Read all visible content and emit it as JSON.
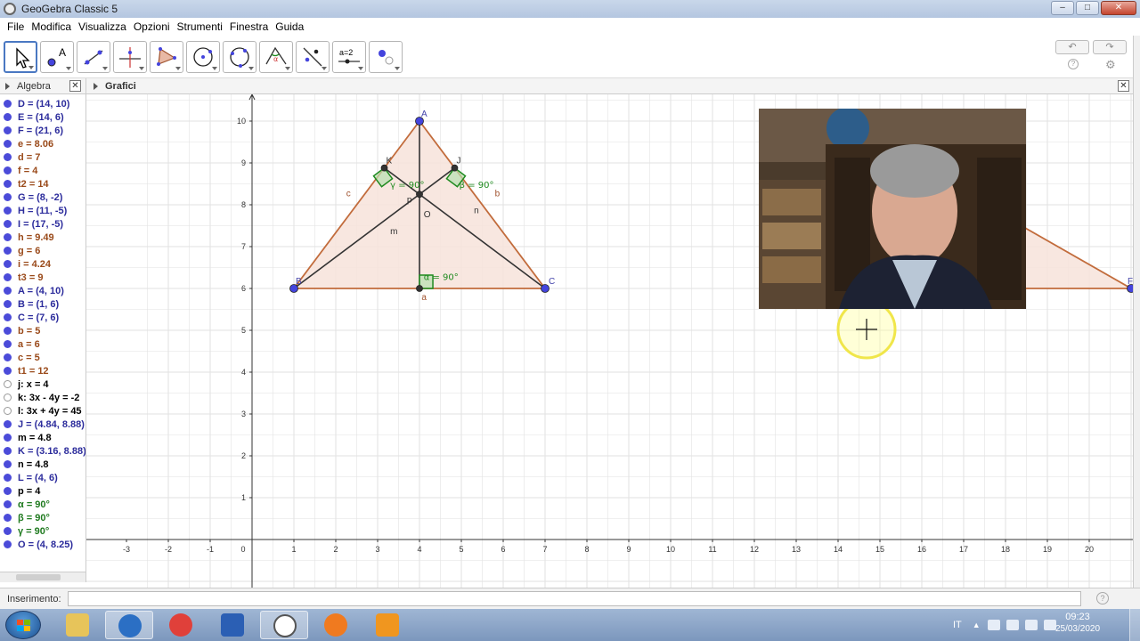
{
  "window": {
    "title": "GeoGebra Classic 5",
    "controls": {
      "minimize": "–",
      "maximize": "□",
      "close": "✕"
    }
  },
  "menu": {
    "items": [
      "File",
      "Modifica",
      "Visualizza",
      "Opzioni",
      "Strumenti",
      "Finestra",
      "Guida"
    ]
  },
  "toolbar": {
    "tools": [
      {
        "icon": "move-arrow-icon",
        "selected": true
      },
      {
        "icon": "point-icon",
        "label": "A"
      },
      {
        "icon": "line-icon"
      },
      {
        "icon": "perpendicular-line-icon"
      },
      {
        "icon": "polygon-icon"
      },
      {
        "icon": "circle-center-point-icon"
      },
      {
        "icon": "circle-three-points-icon"
      },
      {
        "icon": "angle-icon"
      },
      {
        "icon": "reflect-icon"
      },
      {
        "icon": "slider-icon",
        "label": "a=2"
      },
      {
        "icon": "show-hide-icon"
      }
    ],
    "undo": "↶",
    "redo": "↷",
    "help": "?",
    "settings": "⚙"
  },
  "algebra": {
    "title": "Algebra",
    "close": "✕",
    "rows": [
      {
        "text": "D = (14, 10)",
        "dot": "#4b4bd9",
        "color": "#2c2c9c"
      },
      {
        "text": "E = (14, 6)",
        "dot": "#4b4bd9",
        "color": "#2c2c9c"
      },
      {
        "text": "F = (21, 6)",
        "dot": "#4b4bd9",
        "color": "#2c2c9c"
      },
      {
        "text": "e = 8.06",
        "dot": "#4b4bd9",
        "color": "#9a4a1a"
      },
      {
        "text": "d = 7",
        "dot": "#4b4bd9",
        "color": "#9a4a1a"
      },
      {
        "text": "f = 4",
        "dot": "#4b4bd9",
        "color": "#9a4a1a"
      },
      {
        "text": "t2 = 14",
        "dot": "#4b4bd9",
        "color": "#9a4a1a"
      },
      {
        "text": "G = (8, -2)",
        "dot": "#4b4bd9",
        "color": "#2c2c9c"
      },
      {
        "text": "H = (11, -5)",
        "dot": "#4b4bd9",
        "color": "#2c2c9c"
      },
      {
        "text": "I = (17, -5)",
        "dot": "#4b4bd9",
        "color": "#2c2c9c"
      },
      {
        "text": "h = 9.49",
        "dot": "#4b4bd9",
        "color": "#9a4a1a"
      },
      {
        "text": "g = 6",
        "dot": "#4b4bd9",
        "color": "#9a4a1a"
      },
      {
        "text": "i = 4.24",
        "dot": "#4b4bd9",
        "color": "#9a4a1a"
      },
      {
        "text": "t3 = 9",
        "dot": "#4b4bd9",
        "color": "#9a4a1a"
      },
      {
        "text": "A = (4, 10)",
        "dot": "#4b4bd9",
        "color": "#2c2c9c"
      },
      {
        "text": "B = (1, 6)",
        "dot": "#4b4bd9",
        "color": "#2c2c9c"
      },
      {
        "text": "C = (7, 6)",
        "dot": "#4b4bd9",
        "color": "#2c2c9c"
      },
      {
        "text": "b = 5",
        "dot": "#4b4bd9",
        "color": "#9a4a1a"
      },
      {
        "text": "a = 6",
        "dot": "#4b4bd9",
        "color": "#9a4a1a"
      },
      {
        "text": "c = 5",
        "dot": "#4b4bd9",
        "color": "#9a4a1a"
      },
      {
        "text": "t1 = 12",
        "dot": "#4b4bd9",
        "color": "#9a4a1a"
      },
      {
        "text": "j: x = 4",
        "dot": "hollow",
        "color": "#000000"
      },
      {
        "text": "k: 3x - 4y = -2",
        "dot": "hollow",
        "color": "#000000"
      },
      {
        "text": "l: 3x + 4y = 45",
        "dot": "hollow",
        "color": "#000000"
      },
      {
        "text": "J = (4.84, 8.88)",
        "dot": "#4b4bd9",
        "color": "#2c2c9c"
      },
      {
        "text": "m = 4.8",
        "dot": "#4b4bd9",
        "color": "#000000"
      },
      {
        "text": "K = (3.16, 8.88)",
        "dot": "#4b4bd9",
        "color": "#2c2c9c"
      },
      {
        "text": "n = 4.8",
        "dot": "#4b4bd9",
        "color": "#000000"
      },
      {
        "text": "L = (4, 6)",
        "dot": "#4b4bd9",
        "color": "#2c2c9c"
      },
      {
        "text": "p = 4",
        "dot": "#4b4bd9",
        "color": "#000000"
      },
      {
        "text": "α = 90°",
        "dot": "#4b4bd9",
        "color": "#1f7a1f"
      },
      {
        "text": "β = 90°",
        "dot": "#4b4bd9",
        "color": "#1f7a1f"
      },
      {
        "text": "γ = 90°",
        "dot": "#4b4bd9",
        "color": "#1f7a1f"
      },
      {
        "text": "O = (4, 8.25)",
        "dot": "#4b4bd9",
        "color": "#2c2c9c"
      }
    ]
  },
  "graphics": {
    "title": "Grafici",
    "close": "✕",
    "x_ticks": [
      "-3",
      "-2",
      "-1",
      "0",
      "1",
      "2",
      "3",
      "4",
      "5",
      "6",
      "7",
      "8",
      "9",
      "10",
      "11",
      "12",
      "13",
      "14",
      "15",
      "16",
      "17",
      "18",
      "19",
      "20"
    ],
    "y_ticks": [
      "1",
      "2",
      "3",
      "4",
      "5",
      "6",
      "7",
      "8",
      "9",
      "10"
    ],
    "points": [
      {
        "label": "A",
        "x": 4,
        "y": 10,
        "style": "blue"
      },
      {
        "label": "B",
        "x": 1,
        "y": 6,
        "style": "blue"
      },
      {
        "label": "C",
        "x": 7,
        "y": 6,
        "style": "blue"
      },
      {
        "label": "K",
        "x": 3.16,
        "y": 8.88,
        "style": "black"
      },
      {
        "label": "J",
        "x": 4.84,
        "y": 8.88,
        "style": "black"
      },
      {
        "label": "",
        "x": 4,
        "y": 6,
        "style": "black"
      },
      {
        "label": "",
        "x": 4,
        "y": 8.25,
        "style": "black"
      },
      {
        "label": "F",
        "x": 21,
        "y": 6,
        "style": "blue"
      }
    ],
    "segment_labels": [
      {
        "text": "c",
        "x": 2.25,
        "y": 8.2
      },
      {
        "text": "b",
        "x": 5.8,
        "y": 8.2
      },
      {
        "text": "a",
        "x": 4.05,
        "y": 5.72
      },
      {
        "text": "m",
        "x": 3.3,
        "y": 7.3
      },
      {
        "text": "n",
        "x": 5.3,
        "y": 7.8
      },
      {
        "text": "p",
        "x": 3.7,
        "y": 8.05
      },
      {
        "text": "O",
        "x": 4.1,
        "y": 7.7
      }
    ],
    "angle_labels": [
      {
        "text": "γ = 90°",
        "x": 3.3,
        "y": 8.4
      },
      {
        "text": "β = 90°",
        "x": 4.95,
        "y": 8.4
      },
      {
        "text": "α = 90°",
        "x": 4.1,
        "y": 6.2
      }
    ],
    "colors": {
      "triangle_fill": "#f7e3da",
      "triangle_edge": "#c26c3c",
      "point_blue": "#4444dd",
      "angle_green": "#1f8a1f",
      "grid": "#e2e2e2",
      "axis": "#333333"
    }
  },
  "input_bar": {
    "label": "Inserimento:",
    "value": "",
    "help": "?"
  },
  "taskbar": {
    "apps": [
      {
        "name": "explorer",
        "color": "#e7c45a"
      },
      {
        "name": "media-player",
        "color": "#2b6fc4",
        "active": true
      },
      {
        "name": "chrome",
        "color": "#e0403a"
      },
      {
        "name": "word",
        "color": "#2b5fb4"
      },
      {
        "name": "geogebra",
        "color": "#ffffff",
        "active": true
      },
      {
        "name": "firefox",
        "color": "#f07a1f"
      },
      {
        "name": "video-app",
        "color": "#f0961f"
      }
    ],
    "lang": "IT",
    "time": "09:23",
    "date": "25/03/2020"
  }
}
